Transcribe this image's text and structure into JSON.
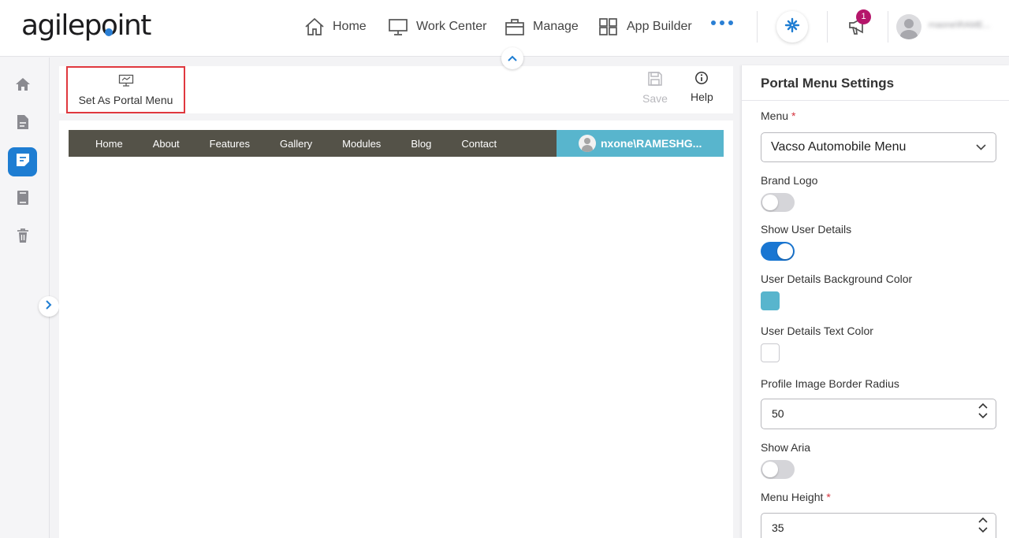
{
  "app": {
    "logo_text_a": "agilep",
    "logo_text_b": "int"
  },
  "nav": [
    {
      "label": "Home",
      "icon": "home-icon"
    },
    {
      "label": "Work Center",
      "icon": "monitor-icon"
    },
    {
      "label": "Manage",
      "icon": "briefcase-icon"
    },
    {
      "label": "App Builder",
      "icon": "grid-icon"
    }
  ],
  "header": {
    "notification_count": "1",
    "user_name": "rnaone\\RAME..."
  },
  "sidebar": {
    "items": [
      "home-icon",
      "document-icon",
      "portal-menu-icon",
      "book-icon",
      "trash-icon"
    ],
    "active_index": 2
  },
  "toolbar": {
    "set_portal_label": "Set As Portal Menu",
    "save_label": "Save",
    "help_label": "Help"
  },
  "preview": {
    "menu_items": [
      "Home",
      "About",
      "Features",
      "Gallery",
      "Modules",
      "Blog",
      "Contact"
    ],
    "user_text": "nxone\\RAMESHG...",
    "bar_color": "#545248",
    "user_bg_color": "#58b5cd"
  },
  "panel": {
    "title": "Portal Menu Settings",
    "menu_label": "Menu",
    "menu_value": "Vacso Automobile Menu",
    "brand_logo_label": "Brand Logo",
    "brand_logo_on": false,
    "show_user_details_label": "Show User Details",
    "show_user_details_on": true,
    "user_bg_color_label": "User Details Background Color",
    "user_bg_color_value": "#58b5cd",
    "user_text_color_label": "User Details Text Color",
    "user_text_color_value": "#ffffff",
    "border_radius_label": "Profile Image Border Radius",
    "border_radius_value": "50",
    "show_aria_label": "Show Aria",
    "show_aria_on": false,
    "menu_height_label": "Menu Height",
    "menu_height_value": "35",
    "required_mark": "*"
  }
}
